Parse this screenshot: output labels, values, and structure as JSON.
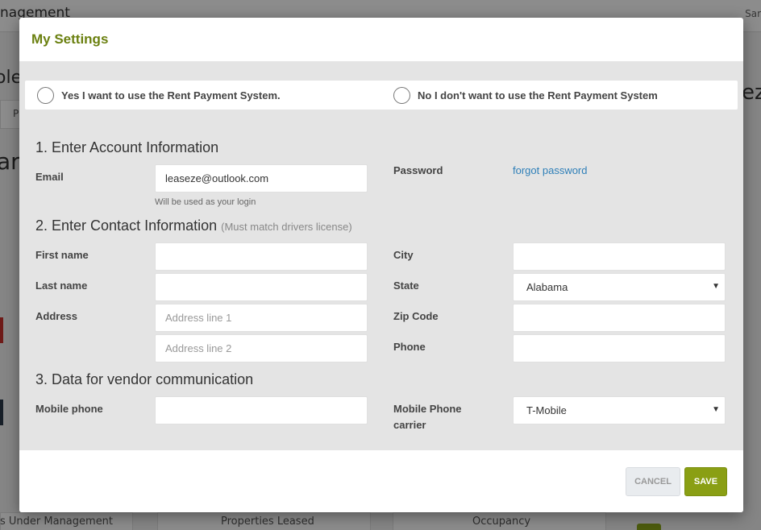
{
  "background": {
    "app_title": "nagement",
    "user": "Sar",
    "brand_left": "ole",
    "brand_right": "ez",
    "tab_text": "P",
    "big_text": "ar",
    "stats": [
      "s Under Management",
      "Properties Leased",
      "Occupancy"
    ]
  },
  "modal": {
    "title": "My Settings",
    "radio_yes": "Yes I want to use the Rent Payment System.",
    "radio_no": "No I don't want to use the Rent Payment System",
    "section1": "1. Enter Account Information",
    "email_label": "Email",
    "email_value": "leaseze@outlook.com",
    "email_hint": "Will be used as your login",
    "password_label": "Password",
    "forgot_password": "forgot password",
    "section2": "2. Enter Contact Information",
    "section2_note": "(Must match drivers license)",
    "first_name_label": "First name",
    "last_name_label": "Last name",
    "address_label": "Address",
    "address1_placeholder": "Address line 1",
    "address2_placeholder": "Address line 2",
    "city_label": "City",
    "state_label": "State",
    "state_value": "Alabama",
    "zip_label": "Zip Code",
    "phone_label": "Phone",
    "section3": "3. Data for vendor communication",
    "mobile_phone_label": "Mobile phone",
    "carrier_label_line1": "Mobile Phone",
    "carrier_label_line2": "carrier",
    "carrier_value": "T-Mobile",
    "cancel": "CANCEL",
    "save": "SAVE"
  },
  "colors": {
    "accent": "#8a9f14",
    "title": "#6b8010",
    "link": "#2e7fb8"
  }
}
